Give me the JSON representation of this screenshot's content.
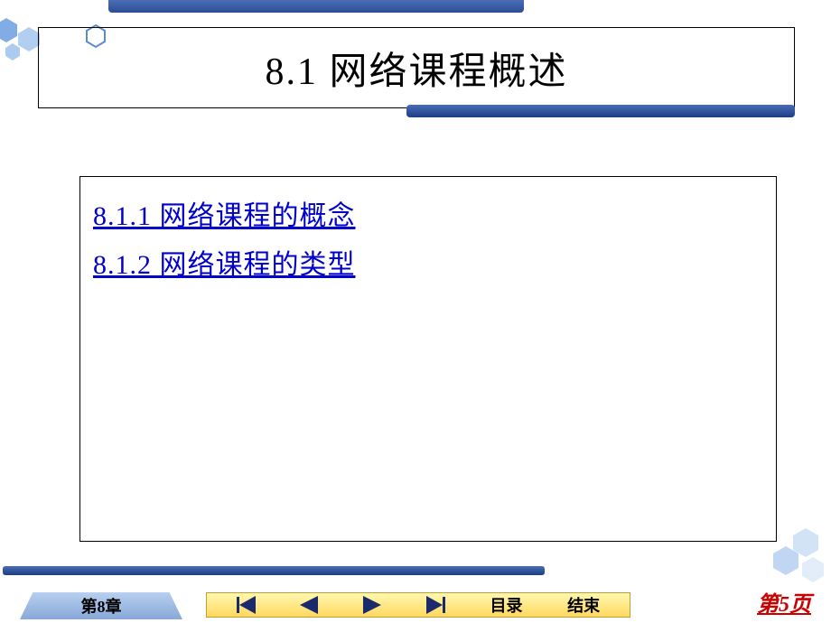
{
  "header": {
    "title": "8.1  网络课程概述"
  },
  "content": {
    "links": [
      "8.1.1  网络课程的概念",
      "8.1.2  网络课程的类型"
    ]
  },
  "footer": {
    "chapter": "第8章",
    "toc": "目录",
    "end": "结束",
    "page": "第5页"
  },
  "colors": {
    "accent_blue": "#2a4d95",
    "link_blue": "#0000cc",
    "page_red": "#cc0000",
    "nav_yellow": "#ffd860"
  }
}
